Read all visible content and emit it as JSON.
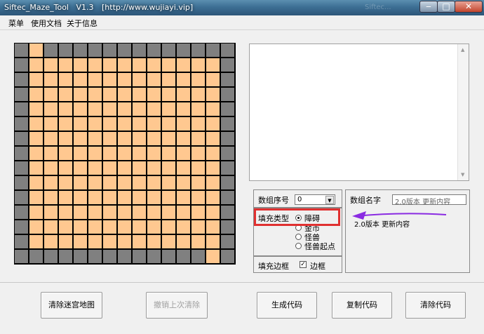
{
  "window": {
    "title": "Siftec_Maze_Tool   V1.3",
    "url": "[http://www.wujiayi.vip]",
    "faint_text": "Siftec..."
  },
  "menu": [
    "菜单",
    "使用文档",
    "关于信息"
  ],
  "maze": {
    "cols": 15,
    "rows": 15,
    "wall_color": "#808080",
    "path_color": "#ffc890",
    "path_cells": [
      [
        1,
        0
      ],
      [
        1,
        1
      ],
      [
        2,
        1
      ],
      [
        3,
        1
      ],
      [
        4,
        1
      ],
      [
        5,
        1
      ],
      [
        6,
        1
      ],
      [
        7,
        1
      ],
      [
        8,
        1
      ],
      [
        9,
        1
      ],
      [
        10,
        1
      ],
      [
        11,
        1
      ],
      [
        12,
        1
      ],
      [
        13,
        1
      ]
    ],
    "inner_fill": {
      "col_from": 1,
      "col_to": 13,
      "row_from": 1,
      "row_to": 13
    }
  },
  "array_index": {
    "label": "数组序号",
    "value": "0"
  },
  "array_name": {
    "label": "数组名字",
    "value": "2.0版本 更新内容",
    "preview": "2.0版本 更新内容"
  },
  "fill_type": {
    "label": "填充类型",
    "options": [
      "障碍",
      "金币",
      "怪兽",
      "怪兽起点"
    ],
    "selected": 0
  },
  "fill_border": {
    "label": "填充边框",
    "checkbox_label": "边框",
    "checked": true
  },
  "buttons": {
    "clear_map": "清除迷宫地图",
    "undo": "撤销上次清除",
    "generate": "生成代码",
    "copy": "复制代码",
    "clear_code": "清除代码"
  },
  "colors": {
    "highlight_box": "#e03030",
    "arrow": "#8a2be2"
  }
}
